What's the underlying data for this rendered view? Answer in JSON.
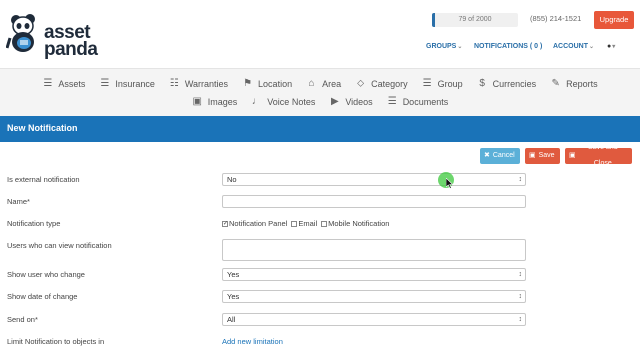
{
  "brand": {
    "name_line1": "asset",
    "name_line2": "panda"
  },
  "header": {
    "usage_text": "79 of 2000",
    "usage_fraction": 0.0395,
    "phone": "(855) 214-1521",
    "upgrade_label": "Upgrade",
    "nav": {
      "groups": "GROUPS",
      "notifications": "NOTIFICATIONS ( 0 )",
      "account": "ACCOUNT"
    }
  },
  "menu": {
    "row1": [
      {
        "label": "Assets",
        "icon": "document-icon"
      },
      {
        "label": "Insurance",
        "icon": "document-icon"
      },
      {
        "label": "Warranties",
        "icon": "list-icon"
      },
      {
        "label": "Location",
        "icon": "map-pin-icon"
      },
      {
        "label": "Area",
        "icon": "home-icon"
      },
      {
        "label": "Category",
        "icon": "tags-icon"
      },
      {
        "label": "Group",
        "icon": "document-icon"
      },
      {
        "label": "Currencies",
        "icon": "dollar-icon"
      },
      {
        "label": "Reports",
        "icon": "edit-icon"
      }
    ],
    "row2": [
      {
        "label": "Images",
        "icon": "camera-icon"
      },
      {
        "label": "Voice Notes",
        "icon": "microphone-icon"
      },
      {
        "label": "Videos",
        "icon": "video-icon"
      },
      {
        "label": "Documents",
        "icon": "document-icon"
      }
    ]
  },
  "page": {
    "title": "New Notification"
  },
  "actions": {
    "cancel": "Cancel",
    "save": "Save",
    "save_close": "Save and Close"
  },
  "form": {
    "external": {
      "label": "Is external notification",
      "value": "No"
    },
    "name": {
      "label": "Name*",
      "value": ""
    },
    "type": {
      "label": "Notification type",
      "options": [
        {
          "label": "Notification Panel",
          "checked": true
        },
        {
          "label": "Email",
          "checked": false
        },
        {
          "label": "Mobile Notification",
          "checked": false
        }
      ]
    },
    "users": {
      "label": "Users who can view notification",
      "value": ""
    },
    "show_user": {
      "label": "Show user who change",
      "value": "Yes"
    },
    "show_date": {
      "label": "Show date of change",
      "value": "Yes"
    },
    "send_on": {
      "label": "Send on*",
      "value": "All"
    },
    "limit": {
      "label": "Limit Notification to objects in",
      "link": "Add new limitation"
    }
  }
}
